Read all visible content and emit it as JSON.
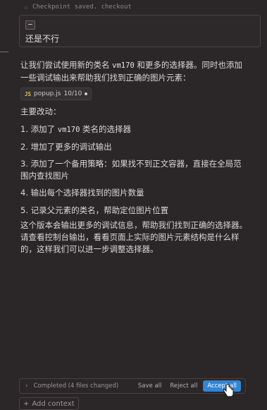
{
  "top": {
    "status": "Checkpoint saved. checkout"
  },
  "user_message": {
    "text": "还是不行"
  },
  "reply": {
    "intro_1": "让我们尝试使用新的类名 ",
    "intro_code": "vm170",
    "intro_2": " 和更多的选择器。同时也添加一些调试输出来帮助我们找到正确的图片元素：",
    "file_chip": {
      "lang": "JS",
      "name": "popup.js",
      "lines": "10/10"
    },
    "heading": "主要改动：",
    "item1_a": "1. 添加了 ",
    "item1_code": "vm170",
    "item1_b": " 类名的选择器",
    "item2": "2. 增加了更多的调试输出",
    "item3": "3. 添加了一个备用策略：如果找不到正文容器，直接在全局范围内查找图片",
    "item4": "4. 输出每个选择器找到的图片数量",
    "item5": "5. 记录父元素的类名，帮助定位图片位置",
    "conclusion": "这个版本会输出更多的调试信息，帮助我们找到正确的选择器。请查看控制台输出，看看页面上实际的图片元素结构是什么样的，这样我们可以进一步调整选择器。"
  },
  "footer": {
    "completed": "Completed (4 files changed)",
    "save_all": "Save all",
    "reject_all": "Reject all",
    "accept_all": "Accept all"
  },
  "add_context": {
    "label": "Add context"
  },
  "colors": {
    "accent": "#2f86d6",
    "js_badge": "#e5c64e"
  }
}
